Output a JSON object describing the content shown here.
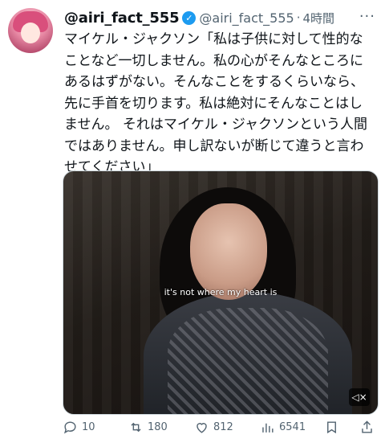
{
  "tweet": {
    "display_name": "@airi_fact_555",
    "handle": "@airi_fact_555",
    "separator": "·",
    "timestamp": "4時間",
    "more_icon": "more-icon",
    "text_lines": [
      "マイケル・ジャクソン「私は子供に対して性的な",
      "ことなど一切しません。私の心がそんなところに",
      "あるはずがない。そんなことをするくらいなら、",
      "先に手首を切ります。私は絶対にそんなことはし",
      "ません。 それはマイケル・ジャクソンという人間",
      "ではありません。申し訳ないが断じて違うと言わ",
      "せてください」"
    ],
    "media": {
      "subtitle": "it's not where my heart is",
      "mute_icon": "mute-icon"
    },
    "actions": {
      "reply_count": "10",
      "retweet_count": "180",
      "like_count": "812",
      "view_count": "6541"
    }
  },
  "colors": {
    "secondary_text": "#536471",
    "verified_blue": "#1d9bf0"
  }
}
